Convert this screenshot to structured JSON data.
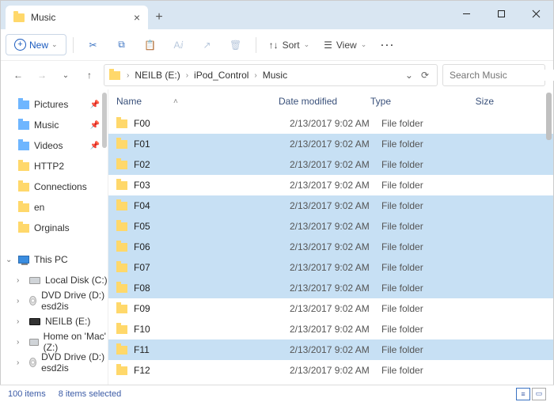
{
  "tab": {
    "title": "Music"
  },
  "toolbar": {
    "new": "New",
    "sort": "Sort",
    "view": "View"
  },
  "breadcrumb": [
    "NEILB (E:)",
    "iPod_Control",
    "Music"
  ],
  "search": {
    "placeholder": "Search Music"
  },
  "navpane": {
    "quick": [
      {
        "label": "Pictures",
        "icon": "blue",
        "pinned": true
      },
      {
        "label": "Music",
        "icon": "blue",
        "pinned": true
      },
      {
        "label": "Videos",
        "icon": "blue",
        "pinned": true
      },
      {
        "label": "HTTP2",
        "icon": "yellow",
        "pinned": false
      },
      {
        "label": "Connections",
        "icon": "yellow",
        "pinned": false
      },
      {
        "label": "en",
        "icon": "yellow",
        "pinned": false
      },
      {
        "label": "Orginals",
        "icon": "yellow",
        "pinned": false
      }
    ],
    "thispc": "This PC",
    "drives": [
      {
        "label": "Local Disk (C:)",
        "icon": "drive"
      },
      {
        "label": "DVD Drive (D:) esd2is",
        "icon": "disc"
      },
      {
        "label": "NEILB (E:)",
        "icon": "drive-dark"
      },
      {
        "label": "Home on 'Mac' (Z:)",
        "icon": "drive"
      },
      {
        "label": "DVD Drive (D:) esd2is",
        "icon": "disc"
      }
    ]
  },
  "columns": {
    "name": "Name",
    "date": "Date modified",
    "type": "Type",
    "size": "Size"
  },
  "rows": [
    {
      "name": "F00",
      "date": "2/13/2017 9:02 AM",
      "type": "File folder",
      "selected": false
    },
    {
      "name": "F01",
      "date": "2/13/2017 9:02 AM",
      "type": "File folder",
      "selected": true
    },
    {
      "name": "F02",
      "date": "2/13/2017 9:02 AM",
      "type": "File folder",
      "selected": true
    },
    {
      "name": "F03",
      "date": "2/13/2017 9:02 AM",
      "type": "File folder",
      "selected": false
    },
    {
      "name": "F04",
      "date": "2/13/2017 9:02 AM",
      "type": "File folder",
      "selected": true
    },
    {
      "name": "F05",
      "date": "2/13/2017 9:02 AM",
      "type": "File folder",
      "selected": true
    },
    {
      "name": "F06",
      "date": "2/13/2017 9:02 AM",
      "type": "File folder",
      "selected": true
    },
    {
      "name": "F07",
      "date": "2/13/2017 9:02 AM",
      "type": "File folder",
      "selected": true
    },
    {
      "name": "F08",
      "date": "2/13/2017 9:02 AM",
      "type": "File folder",
      "selected": true
    },
    {
      "name": "F09",
      "date": "2/13/2017 9:02 AM",
      "type": "File folder",
      "selected": false
    },
    {
      "name": "F10",
      "date": "2/13/2017 9:02 AM",
      "type": "File folder",
      "selected": false
    },
    {
      "name": "F11",
      "date": "2/13/2017 9:02 AM",
      "type": "File folder",
      "selected": true
    },
    {
      "name": "F12",
      "date": "2/13/2017 9:02 AM",
      "type": "File folder",
      "selected": false
    }
  ],
  "status": {
    "count": "100 items",
    "selected": "8 items selected"
  }
}
